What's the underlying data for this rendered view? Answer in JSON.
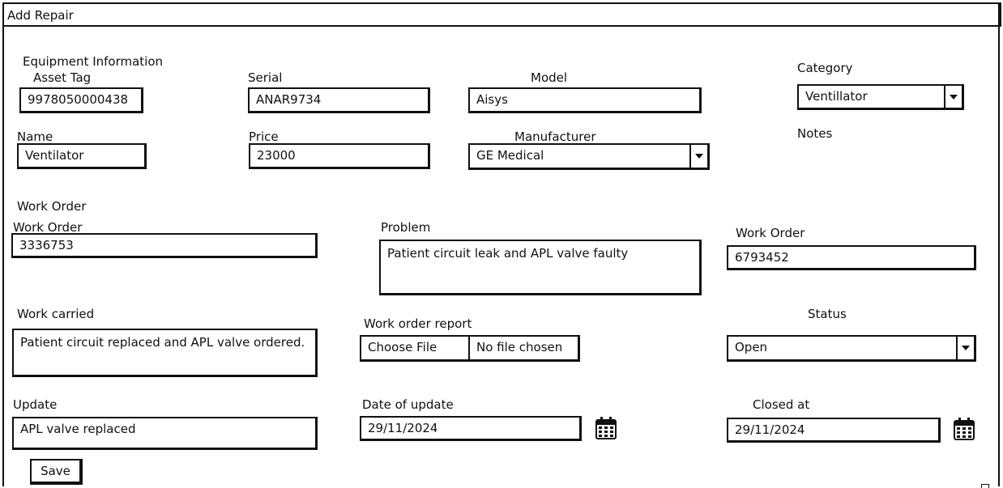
{
  "window": {
    "title": "Add Repair"
  },
  "equipment": {
    "section_title": "Equipment Information",
    "asset_tag_label": "Asset Tag",
    "asset_tag_value": "9978050000438",
    "serial_label": "Serial",
    "serial_value": "ANAR9734",
    "model_label": "Model",
    "model_value": "Aisys",
    "category_label": "Category",
    "category_value": "Ventillator",
    "name_label": "Name",
    "name_value": "Ventilator",
    "price_label": "Price",
    "price_value": "23000",
    "manufacturer_label": "Manufacturer",
    "manufacturer_value": "GE Medical",
    "notes_label": "Notes"
  },
  "work_order": {
    "section_title": "Work Order",
    "work_order_label": "Work Order",
    "work_order_value": "3336753",
    "problem_label": "Problem",
    "problem_value": "Patient circuit leak and APL valve faulty",
    "work_order2_label": "Work Order",
    "work_order2_value": "6793452",
    "work_carried_label": "Work carried",
    "work_carried_value": "Patient circuit replaced and APL valve ordered.",
    "report_label": "Work order report",
    "choose_file_label": "Choose File",
    "no_file_label": "No file chosen",
    "status_label": "Status",
    "status_value": "Open",
    "update_label": "Update",
    "update_value": "APL valve replaced",
    "date_update_label": "Date of update",
    "date_update_value": "29/11/2024",
    "closed_at_label": "Closed at",
    "closed_at_value": "29/11/2024",
    "save_label": "Save"
  },
  "icons": {
    "calendar": "calendar-icon",
    "dropdown": "chevron-down-icon"
  }
}
